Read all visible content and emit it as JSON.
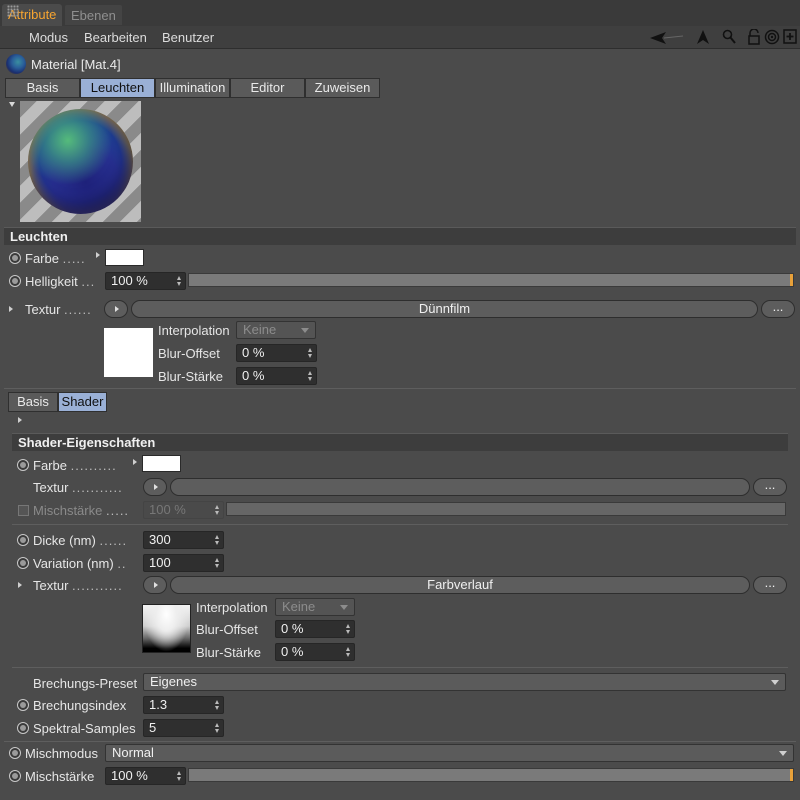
{
  "tabs": {
    "attribute": "Attribute",
    "ebenen": "Ebenen"
  },
  "menu": {
    "modus": "Modus",
    "bearbeiten": "Bearbeiten",
    "benutzer": "Benutzer"
  },
  "material": {
    "title": "Material [Mat.4]"
  },
  "subtabs": [
    "Basis",
    "Leuchten",
    "Illumination",
    "Editor",
    "Zuweisen"
  ],
  "leuchten": {
    "header": "Leuchten",
    "farbe_label": "Farbe",
    "helligkeit_label": "Helligkeit",
    "helligkeit_value": "100 %",
    "helligkeit_fraction": 1.0,
    "textur_label": "Textur",
    "textur_shader": "Dünnfilm",
    "more": "...",
    "interpolation_label": "Interpolation",
    "interpolation_value": "Keine",
    "bluroffset_label": "Blur-Offset",
    "bluroffset_value": "0 %",
    "blurstaerke_label": "Blur-Stärke",
    "blurstaerke_value": "0 %"
  },
  "shader_tabs": [
    "Basis",
    "Shader"
  ],
  "shader": {
    "header": "Shader-Eigenschaften",
    "farbe_label": "Farbe",
    "textur_label": "Textur",
    "mischstaerke_label": "Mischstärke",
    "mischstaerke_value": "100 %",
    "dicke_label": "Dicke (nm)",
    "dicke_value": "300",
    "variation_label": "Variation (nm)",
    "variation_value": "100",
    "textur2_label": "Textur",
    "textur2_shader": "Farbverlauf",
    "interpolation_label": "Interpolation",
    "interpolation_value": "Keine",
    "bluroffset_label": "Blur-Offset",
    "bluroffset_value": "0 %",
    "blurstaerke_label": "Blur-Stärke",
    "blurstaerke_value": "0 %",
    "brechungspreset_label": "Brechungs-Preset",
    "brechungspreset_value": "Eigenes",
    "brechungsindex_label": "Brechungsindex",
    "brechungsindex_value": "1.3",
    "spektral_label": "Spektral-Samples",
    "spektral_value": "5"
  },
  "footer": {
    "mischmodus_label": "Mischmodus",
    "mischmodus_value": "Normal",
    "mischstaerke_label": "Mischstärke",
    "mischstaerke_value": "100 %",
    "mischstaerke_fraction": 1.0
  },
  "dots": {
    "farbe": ".....",
    "helligkeit": "...",
    "textur": "......",
    "s_farbe": "..........",
    "s_textur": "...........",
    "s_misch": ".....",
    "s_dicke": "......",
    "s_variation": "..",
    "s_textur2": "..........."
  },
  "colors": {
    "accent": "#f7a531",
    "active_tab": "#9ab0d6",
    "slider_end": "#e8a13a"
  }
}
